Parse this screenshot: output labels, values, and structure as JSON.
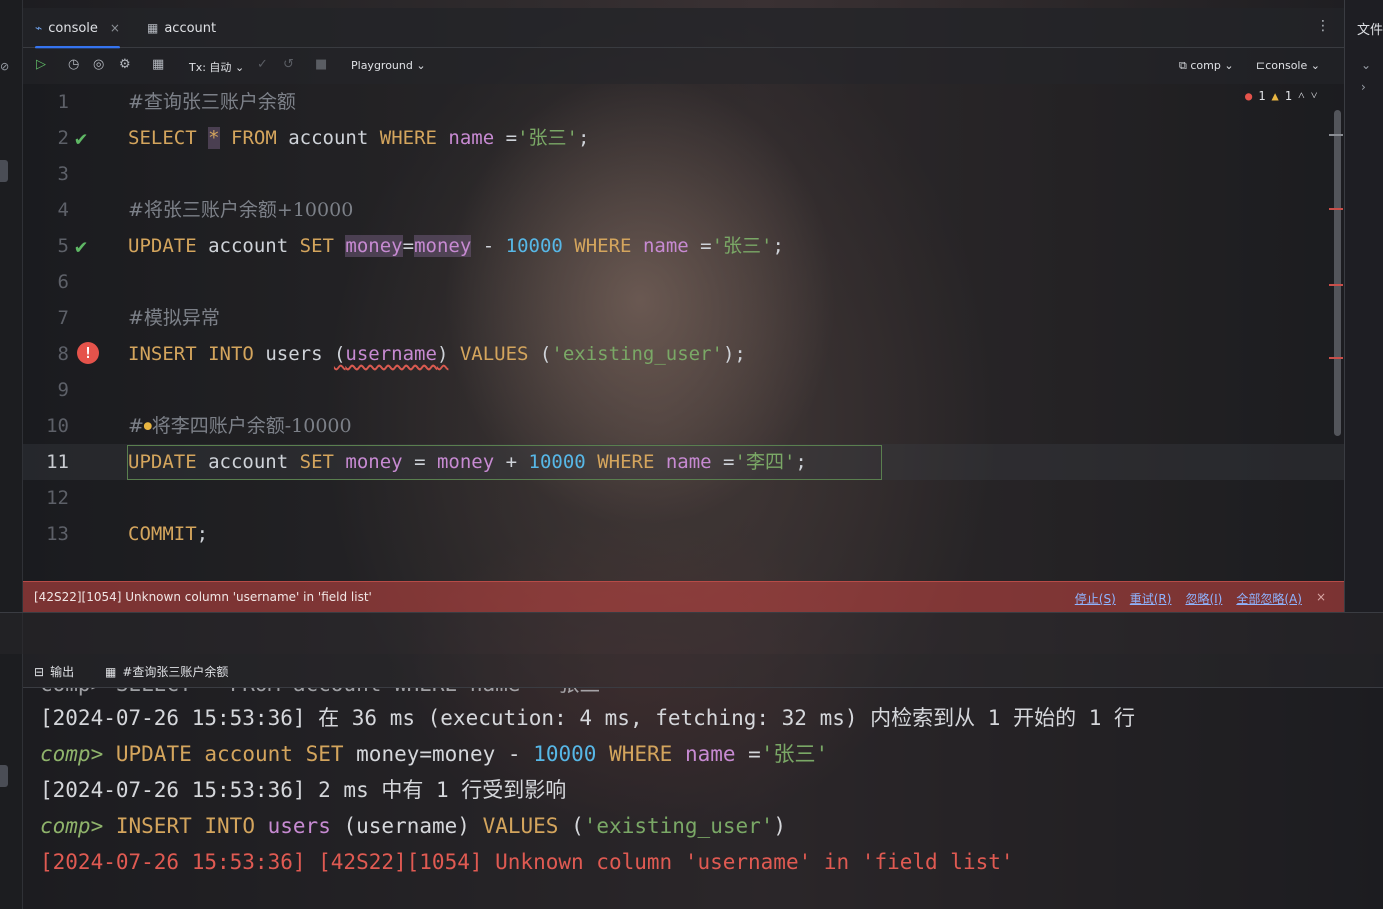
{
  "tabs": [
    {
      "label": "console",
      "icon": "console-icon",
      "active": true
    },
    {
      "label": "account",
      "icon": "table-icon",
      "active": false
    }
  ],
  "right_panel": {
    "title": "文件"
  },
  "toolbar": {
    "tx_label": "Tx: 自动",
    "playground_label": "Playground",
    "schema_label": "comp",
    "session_label": "console"
  },
  "inspections": {
    "errors": "1",
    "warnings": "1"
  },
  "editor": {
    "lines": [
      {
        "n": "1"
      },
      {
        "n": "2"
      },
      {
        "n": "3"
      },
      {
        "n": "4"
      },
      {
        "n": "5"
      },
      {
        "n": "6"
      },
      {
        "n": "7"
      },
      {
        "n": "8"
      },
      {
        "n": "9"
      },
      {
        "n": "10"
      },
      {
        "n": "11"
      },
      {
        "n": "12"
      },
      {
        "n": "13"
      }
    ],
    "tokens": {
      "c1": "#查询张三账户余额",
      "select": "SELECT",
      "star": "*",
      "from": "FROM",
      "account": "account",
      "where": "WHERE",
      "name": "name",
      "eq": " =",
      "zhangsan": "'张三'",
      "semi": ";",
      "c4": "#将张三账户余额+10000",
      "update": "UPDATE",
      "set": "SET",
      "money": "money",
      "eqsign": "=",
      "minus": "-",
      "plus": "+",
      "amount": "10000",
      "c7": "#模拟异常",
      "insert": "INSERT",
      "into": "INTO",
      "users": "users",
      "username": "username",
      "values": "VALUES",
      "existing_user": "'existing_user'",
      "c10a": "#",
      "c10b": "将李四账户余额-10000",
      "lisi": "'李四'",
      "commit": "COMMIT"
    }
  },
  "error_bar": {
    "message": "[42S22][1054] Unknown column 'username' in 'field list'",
    "stop": "停止(S)",
    "retry": "重试(R)",
    "ignore": "忽略(I)",
    "ignore_all": "全部忽略(A)",
    "close": "×"
  },
  "output_tabs": [
    {
      "label": "输出",
      "icon": "output-icon"
    },
    {
      "label": "#查询张三账户余额",
      "icon": "table-icon"
    }
  ],
  "console": {
    "cut_line": "comp> SELECT * FROM account WHERE name ='张三'",
    "l1": "[2024-07-26 15:53:36] 在 36 ms (execution: 4 ms, fetching: 32 ms) 内检索到从 1 开始的 1 行",
    "l2_prompt": "comp>",
    "l2_update": "UPDATE",
    "l2_account": "account",
    "l2_set": "SET",
    "l2_expr": "money=money -",
    "l2_num": "10000",
    "l2_where": "WHERE",
    "l2_name": "name",
    "l2_eq": "=",
    "l2_str": "'张三'",
    "l3": "[2024-07-26 15:53:36] 2 ms 中有 1 行受到影响",
    "l4_prompt": "comp>",
    "l4_insert": "INSERT",
    "l4_into": "INTO",
    "l4_users": "users",
    "l4_cols": "(username)",
    "l4_values": "VALUES",
    "l4_open": "(",
    "l4_str": "'existing_user'",
    "l4_close": ")",
    "l5": "[2024-07-26 15:53:36] [42S22][1054] Unknown column 'username' in 'field list'"
  }
}
